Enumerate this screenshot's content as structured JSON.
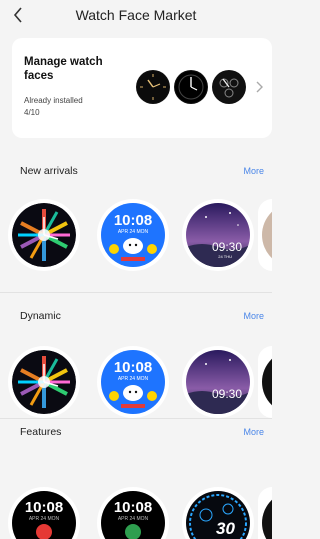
{
  "header": {
    "title": "Watch Face Market",
    "back_icon": "chevron-left-icon"
  },
  "manage": {
    "title": "Manage watch faces",
    "installed_label": "Already installed",
    "installed_count": "4/10"
  },
  "sections": [
    {
      "title": "New arrivals",
      "more": "More",
      "faces": [
        {
          "time": "",
          "date": ""
        },
        {
          "time": "10:08",
          "date": "APR 24  MON"
        },
        {
          "time": "09:30",
          "date": "24 THU"
        }
      ]
    },
    {
      "title": "Dynamic",
      "more": "More",
      "faces": [
        {
          "time": "",
          "date": ""
        },
        {
          "time": "10:08",
          "date": "APR 24  MON"
        },
        {
          "time": "09:30",
          "date": "24 THU"
        }
      ]
    },
    {
      "title": "Features",
      "more": "More",
      "faces": [
        {
          "time": "10:08",
          "date": "APR 24  MON"
        },
        {
          "time": "10:08",
          "date": "APR 24  MON"
        },
        {
          "time": "30",
          "date": ""
        }
      ]
    }
  ],
  "colors": {
    "accent": "#4a86e8",
    "card": "#ffffff",
    "background": "#f4f4f4"
  }
}
